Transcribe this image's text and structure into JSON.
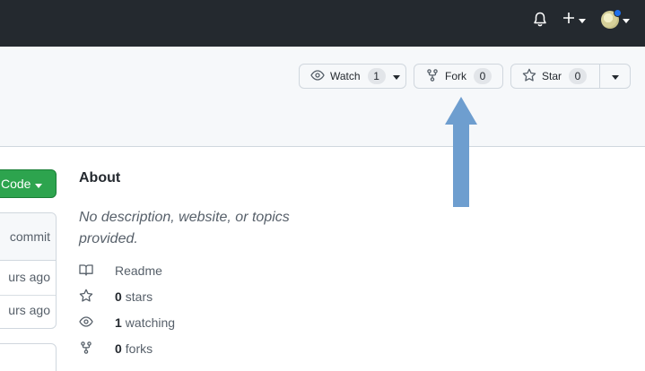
{
  "header": {
    "icons": [
      "bell-icon",
      "plus-icon",
      "caret-down-icon",
      "avatar"
    ]
  },
  "repo_actions": {
    "watch": {
      "label": "Watch",
      "count": "1"
    },
    "fork": {
      "label": "Fork",
      "count": "0"
    },
    "star": {
      "label": "Star",
      "count": "0"
    }
  },
  "annotation": {
    "color": "#6e9ecf",
    "points_to": "fork-button"
  },
  "code_button": {
    "label": "Code"
  },
  "files": {
    "latest_commit": "commit",
    "rows": [
      {
        "age": "urs ago"
      },
      {
        "age": "urs ago"
      }
    ]
  },
  "about": {
    "title": "About",
    "description": "No description, website, or topics provided.",
    "readme": "Readme",
    "stars_count": "0",
    "stars_label": "stars",
    "watching_count": "1",
    "watching_label": "watching",
    "forks_count": "0",
    "forks_label": "forks"
  },
  "colors": {
    "header_bg": "#24292f",
    "green": "#2da44e",
    "arrow": "#6e9ecf",
    "notification_dot": "#1f6feb"
  }
}
